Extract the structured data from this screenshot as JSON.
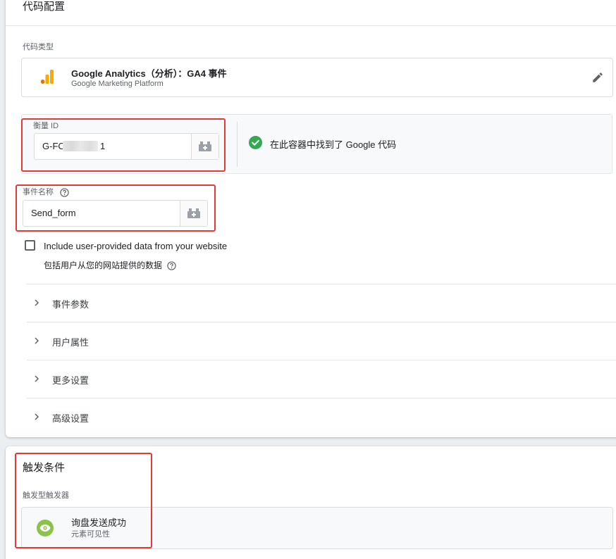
{
  "tag_config": {
    "title": "代码配置",
    "tag_type_label": "代码类型",
    "tag_type": {
      "name": "Google Analytics（分析）：GA4 事件",
      "platform": "Google Marketing Platform",
      "icon": "google-analytics-bars-icon",
      "edit_icon": "pencil-icon"
    },
    "measurement_id": {
      "label": "衡量 ID",
      "value_start": "G-FC",
      "value_end": "1",
      "variable_icon": "variable-picker-icon"
    },
    "tag_found": {
      "icon": "check-circle-icon",
      "text": "在此容器中找到了 Google 代码"
    },
    "event_name": {
      "label": "事件名称",
      "help_icon": "help-icon",
      "value": "Send_form",
      "variable_icon": "variable-picker-icon"
    },
    "user_data": {
      "checked": false,
      "label": "Include user-provided data from your website",
      "sub_label": "包括用户从您的网站提供的数据"
    },
    "sections": [
      {
        "label": "事件参数"
      },
      {
        "label": "用户属性"
      },
      {
        "label": "更多设置"
      },
      {
        "label": "高级设置"
      }
    ]
  },
  "triggering": {
    "title": "触发条件",
    "sub_label": "触发型触发器",
    "trigger": {
      "name": "询盘发送成功",
      "type": "元素可见性",
      "icon": "eye-icon"
    }
  },
  "colors": {
    "highlight_red": "#e53935",
    "ga_orange": "#f9ab00",
    "ga_dark_orange": "#e37400",
    "success_green": "#34a853",
    "trigger_green": "#8bc34a"
  }
}
